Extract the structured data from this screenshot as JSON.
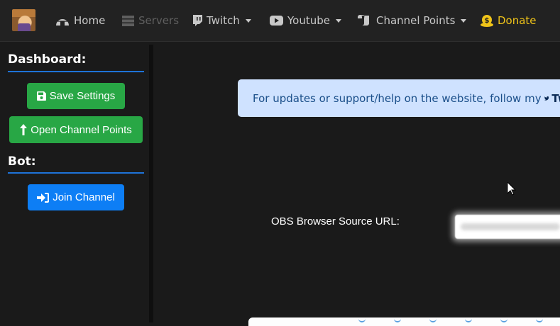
{
  "navbar": {
    "home": "Home",
    "servers": "Servers",
    "twitch": "Twitch",
    "youtube": "Youtube",
    "channel_points": "Channel Points",
    "donate": "Donate"
  },
  "sidebar": {
    "dashboard_heading": "Dashboard:",
    "save_settings": "Save Settings",
    "open_channel_points": "Open Channel Points",
    "bot_heading": "Bot:",
    "join_channel": "Join Channel"
  },
  "main": {
    "alert_text": "For updates or support/help on the website, follow my",
    "alert_link": "Twi",
    "obs_label": "OBS Browser Source URL:",
    "obs_url_value": ""
  },
  "colors": {
    "accent_blue": "#0d7ef5",
    "success_green": "#28a745",
    "donate_gold": "#f0c419",
    "alert_bg": "#cfe2ff"
  },
  "icons": [
    "igloo-icon",
    "server-icon",
    "twitch-icon",
    "youtube-icon",
    "scroll-icon",
    "coin-icon",
    "save-icon",
    "arrow-up-icon",
    "sign-in-icon",
    "twitter-icon",
    "cursor-icon"
  ]
}
